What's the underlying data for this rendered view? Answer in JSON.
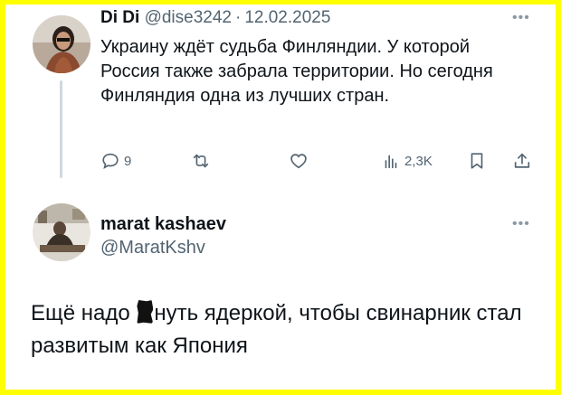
{
  "tweet1": {
    "author_name": "Di Di",
    "handle": "@dise3242",
    "separator": "·",
    "date": "12.02.2025",
    "more_icon": "more-horizontal-icon",
    "text": "Украину ждёт судьба Финляндии. У которой Россия также забрала территории. Но сегодня Финляндия одна из лучших стран.",
    "actions": {
      "reply_count": "9",
      "retweet_count": "",
      "like_count": "",
      "views_count": "2,3K"
    }
  },
  "tweet2": {
    "author_name": "marat kashaev",
    "handle": "@MaratKshv",
    "more_icon": "more-horizontal-icon",
    "text_part1": "Ещё надо ",
    "text_part2": "нуть ядеркой, чтобы свинарник стал развитым как Япония"
  },
  "colors": {
    "frame_border": "#ffff00",
    "text_primary": "#0f1419",
    "text_secondary": "#536471",
    "thread_line": "#cfd9de"
  }
}
